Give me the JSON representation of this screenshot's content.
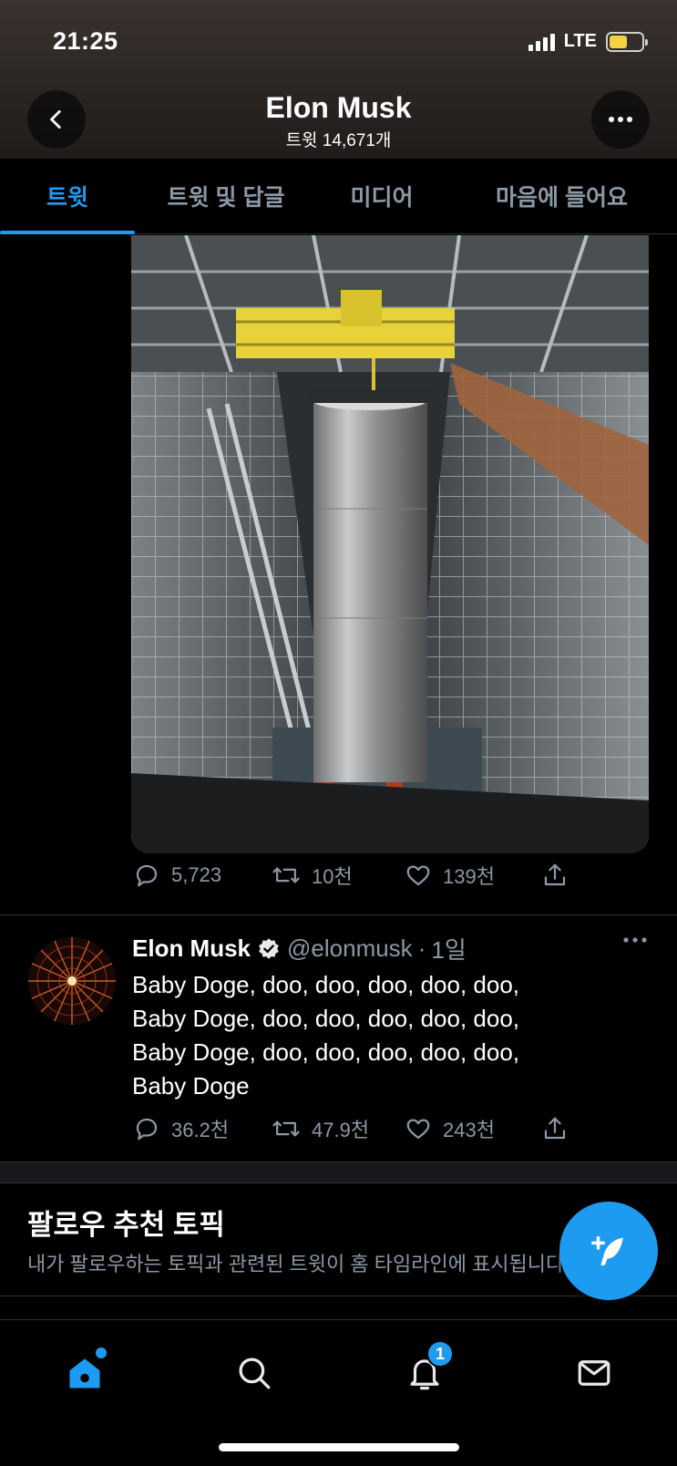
{
  "status_bar": {
    "time": "21:25",
    "network": "LTE"
  },
  "header": {
    "title": "Elon Musk",
    "subtitle": "트윗 14,671개"
  },
  "tabs": [
    {
      "label": "트윗",
      "active": true
    },
    {
      "label": "트윗 및 답글",
      "active": false
    },
    {
      "label": "미디어",
      "active": false
    },
    {
      "label": "마음에 들어요",
      "active": false
    }
  ],
  "tweet1": {
    "image_icon": "rocket-booster-photo",
    "stats": {
      "replies": "5,723",
      "retweets": "10천",
      "likes": "139천"
    }
  },
  "tweet2": {
    "name": "Elon Musk",
    "handle": "@elonmusk",
    "dot": "·",
    "time": "1일",
    "text_lines": [
      "Baby Doge, doo, doo, doo, doo, doo,",
      "Baby Doge, doo, doo, doo, doo, doo,",
      "Baby Doge, doo, doo, doo, doo, doo,",
      "Baby Doge"
    ],
    "stats": {
      "replies": "36.2천",
      "retweets": "47.9천",
      "likes": "243천"
    }
  },
  "topics": {
    "title": "팔로우 추천 토픽",
    "description": "내가 팔로우하는 토픽과 관련된 트윗이 홈 타임라인에 표시됩니다"
  },
  "bottom_nav": {
    "notification_badge": "1"
  },
  "colors": {
    "accent": "#1d9bf0",
    "muted": "#8b98a5",
    "background": "#000000"
  }
}
